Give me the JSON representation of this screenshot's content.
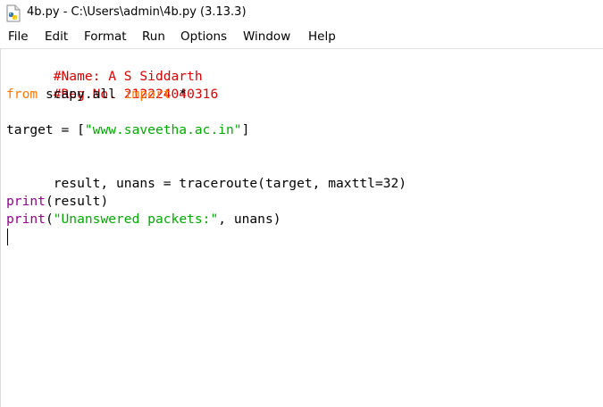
{
  "window": {
    "title": "4b.py - C:\\Users\\admin\\4b.py (3.13.3)",
    "icon": "python-file-icon"
  },
  "menu": {
    "file": "File",
    "edit": "Edit",
    "format": "Format",
    "run": "Run",
    "options": "Options",
    "window": "Window",
    "help": "Help"
  },
  "colors": {
    "comment": "#dd0000",
    "keyword": "#ff7700",
    "builtin": "#900090",
    "string": "#00aa00",
    "text": "#000000"
  },
  "code": {
    "line1": "#Name: A S Siddarth",
    "line2": "#Reg No. 212224040316",
    "line3_kw1": "from",
    "line3_mid": " scapy.all ",
    "line3_kw2": "import",
    "line3_end": " *",
    "line5_pre": "target = [",
    "line5_str": "\"www.saveetha.ac.in\"",
    "line5_post": "]",
    "line7": "result, unans = traceroute(target, maxttl=32)",
    "line9_fn": "print",
    "line9_rest": "(result)",
    "line10_fn": "print",
    "line10_open": "(",
    "line10_str": "\"Unanswered packets:\"",
    "line10_rest": ", unans)"
  }
}
